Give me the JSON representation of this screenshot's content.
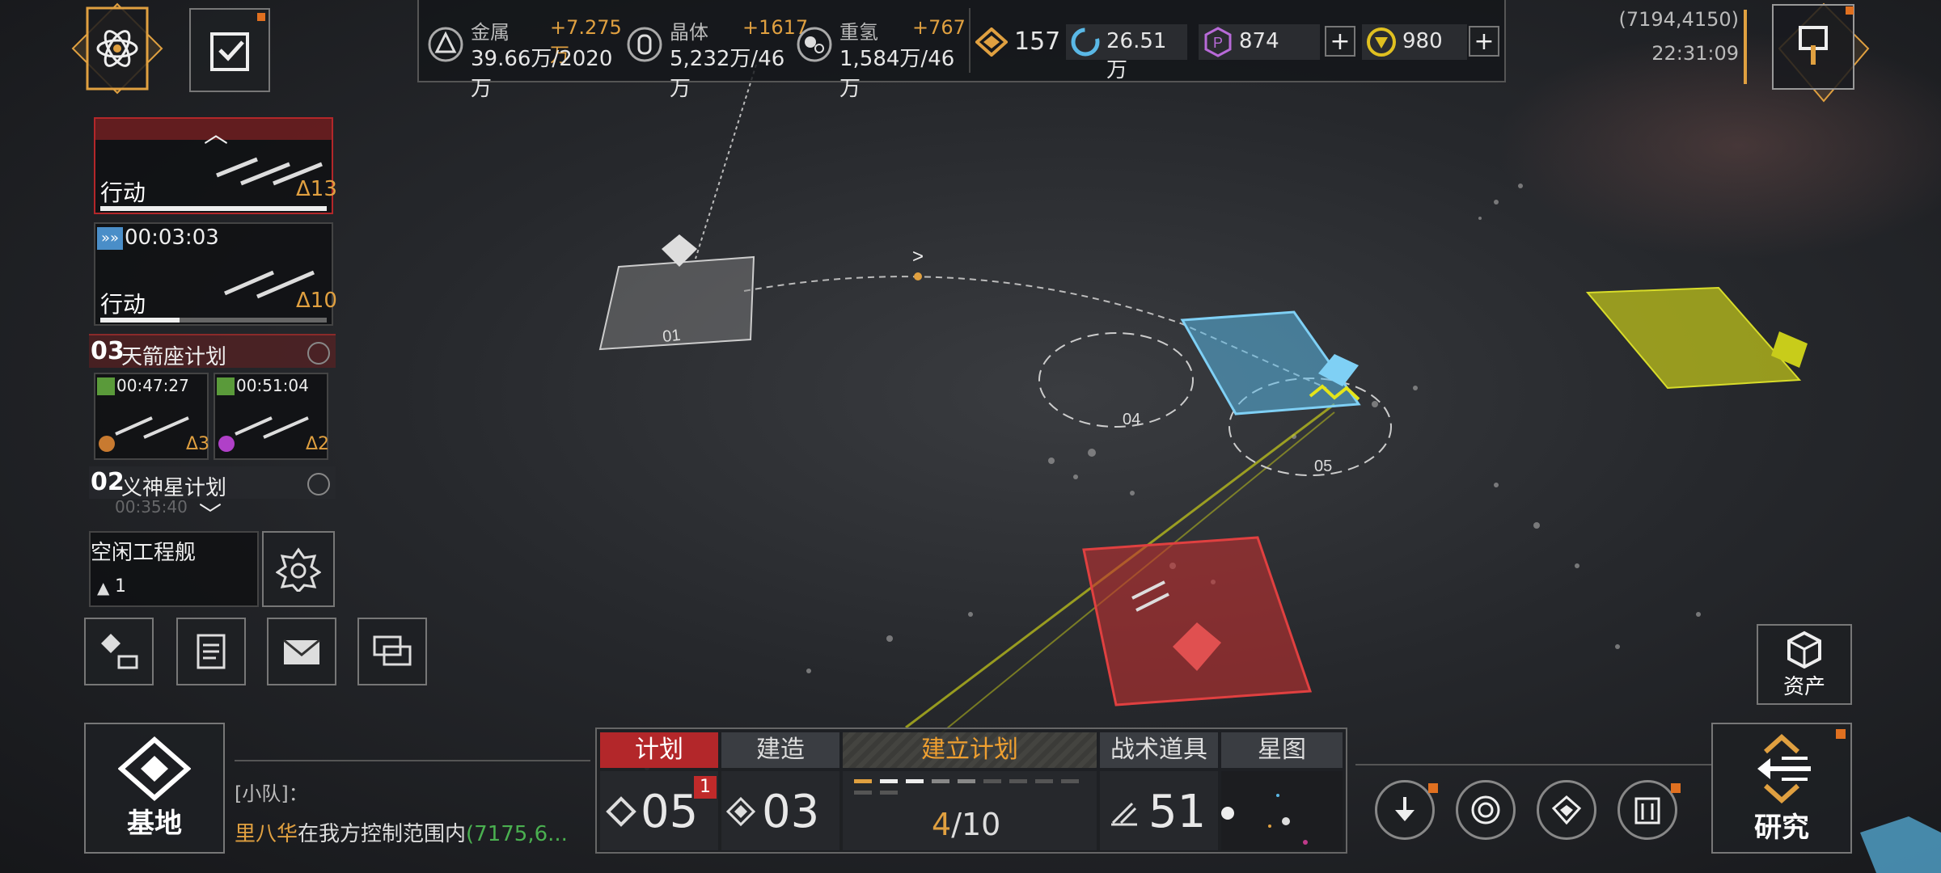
{
  "resources": {
    "metal": {
      "label": "金属",
      "gain": "+7.275万",
      "value": "39.66万/2020万",
      "icon": "metal-icon"
    },
    "crystal": {
      "label": "晶体",
      "gain": "+1617",
      "value": "5,232万/46万",
      "icon": "crystal-icon"
    },
    "deuterium": {
      "label": "重氢",
      "gain": "+767",
      "value": "1,584万/46万",
      "icon": "deuterium-icon"
    },
    "energy": {
      "value": "157",
      "icon": "energy-icon"
    },
    "cycle": {
      "value": "26.51万",
      "icon": "cycle-icon"
    },
    "premium": {
      "value": "874",
      "icon": "hexagon-p-icon"
    },
    "gold": {
      "value": "980",
      "icon": "gold-coin-icon"
    },
    "add_symbol": "+"
  },
  "location": {
    "coords": "(7194,4150)",
    "time": "22:31:09"
  },
  "fleets": [
    {
      "status": "行动",
      "level": "Δ13",
      "progress": 1.0
    },
    {
      "timer": "00:03:03",
      "status": "行动",
      "level": "Δ10",
      "progress": 0.35
    }
  ],
  "plans": [
    {
      "num": "03",
      "name": "天箭座计划",
      "slots": [
        {
          "timer": "00:47:27",
          "level": "Δ3"
        },
        {
          "timer": "00:51:04",
          "level": "Δ2"
        }
      ]
    },
    {
      "num": "02",
      "name": "义神星计划",
      "timer": "00:35:40"
    }
  ],
  "idle_engineer": {
    "label": "空闲工程舰",
    "count": "1"
  },
  "map_labels": [
    "01",
    "04",
    "05"
  ],
  "base_label": "基地",
  "assets_label": "资产",
  "research_label": "研究",
  "chat": {
    "channel": "[小队]：",
    "name": "里八华",
    "message": "在我方控制范围内",
    "coords": "(7175,6..."
  },
  "tabs": [
    "计划",
    "建造",
    "建立计划",
    "战术道具",
    "星图"
  ],
  "counters": {
    "plan": "05",
    "plan_badge": "1",
    "build": "03",
    "build_progress": "4",
    "build_total": "/10",
    "tactics": "51"
  },
  "colors": {
    "accent": "#e0a040",
    "red": "#b3272a",
    "blue": "#5ab8e6",
    "yellow": "#c8cc1a"
  }
}
